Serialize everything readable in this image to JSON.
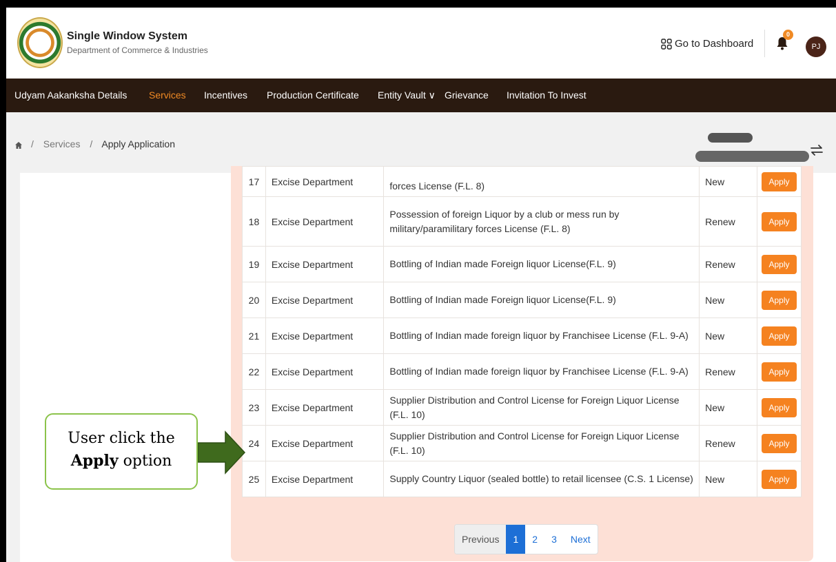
{
  "header": {
    "title": "Single Window System",
    "subtitle": "Department of Commerce & Industries",
    "dashboard_label": "Go to Dashboard",
    "notification_count": "0",
    "avatar_initials": "PJ"
  },
  "nav": {
    "items": [
      {
        "label": "Udyam Aakanksha Details"
      },
      {
        "label": "Services"
      },
      {
        "label": "Incentives"
      },
      {
        "label": "Production Certificate"
      },
      {
        "label": "Entity Vault ∨"
      },
      {
        "label": "Grievance"
      },
      {
        "label": "Invitation To Invest"
      }
    ],
    "active": "Services"
  },
  "breadcrumb": {
    "items": [
      "Services",
      "Apply Application"
    ]
  },
  "table": {
    "rows": [
      {
        "no": "17",
        "dept": "Excise Department",
        "name": "forces License (F.L. 8)",
        "type": "New",
        "action": "Apply"
      },
      {
        "no": "18",
        "dept": "Excise Department",
        "name": "Possession of foreign Liquor by a club or mess run by military/paramilitary forces License (F.L. 8)",
        "type": "Renew",
        "action": "Apply"
      },
      {
        "no": "19",
        "dept": "Excise Department",
        "name": "Bottling of Indian made Foreign liquor License(F.L. 9)",
        "type": "Renew",
        "action": "Apply"
      },
      {
        "no": "20",
        "dept": "Excise Department",
        "name": "Bottling of Indian made Foreign liquor License(F.L. 9)",
        "type": "New",
        "action": "Apply"
      },
      {
        "no": "21",
        "dept": "Excise Department",
        "name": "Bottling of Indian made foreign liquor by Franchisee License (F.L. 9-A)",
        "type": "New",
        "action": "Apply"
      },
      {
        "no": "22",
        "dept": "Excise Department",
        "name": "Bottling of Indian made foreign liquor by Franchisee License (F.L. 9-A)",
        "type": "Renew",
        "action": "Apply"
      },
      {
        "no": "23",
        "dept": "Excise Department",
        "name": "Supplier Distribution and Control License for Foreign Liquor License (F.L. 10)",
        "type": "New",
        "action": "Apply"
      },
      {
        "no": "24",
        "dept": "Excise Department",
        "name": "Supplier Distribution and Control License for Foreign Liquor License (F.L. 10)",
        "type": "Renew",
        "action": "Apply"
      },
      {
        "no": "25",
        "dept": "Excise Department",
        "name": "Supply Country Liquor (sealed bottle) to retail licensee (C.S. 1 License)",
        "type": "New",
        "action": "Apply"
      }
    ]
  },
  "pagination": {
    "previous": "Previous",
    "pages": [
      "1",
      "2",
      "3"
    ],
    "current": "1",
    "next": "Next"
  },
  "callout": {
    "line1": "User click the",
    "bold": "Apply",
    "line2_rest": " option"
  },
  "colors": {
    "nav_bg": "#2a1a10",
    "accent": "#f58220",
    "panel_bg": "#fde0d6",
    "page_active": "#1d6fd6"
  }
}
